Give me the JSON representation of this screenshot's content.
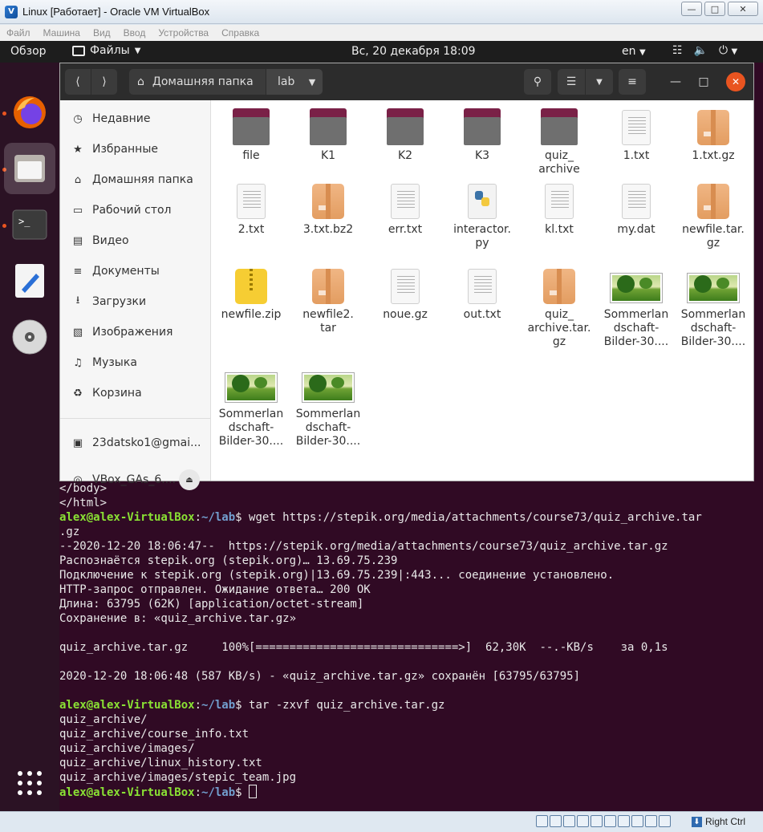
{
  "host": {
    "title": "Linux [Работает] - Oracle VM VirtualBox",
    "app_icon": "virtualbox-icon",
    "menu": [
      "Файл",
      "Машина",
      "Вид",
      "Ввод",
      "Устройства",
      "Справка"
    ],
    "host_key": "Right Ctrl"
  },
  "topbar": {
    "activities": "Обзор",
    "app_menu": "Файлы",
    "clock": "Вс, 20 декабря  18:09",
    "lang": "en"
  },
  "files": {
    "path_home": "Домашняя папка",
    "path_current": "lab",
    "sidebar": [
      {
        "label": "Недавние",
        "icon": "clock-icon"
      },
      {
        "label": "Избранные",
        "icon": "star-icon"
      },
      {
        "label": "Домашняя папка",
        "icon": "home-icon"
      },
      {
        "label": "Рабочий стол",
        "icon": "desktop-icon"
      },
      {
        "label": "Видео",
        "icon": "video-icon"
      },
      {
        "label": "Документы",
        "icon": "document-icon"
      },
      {
        "label": "Загрузки",
        "icon": "download-icon"
      },
      {
        "label": "Изображения",
        "icon": "image-icon"
      },
      {
        "label": "Музыка",
        "icon": "music-icon"
      },
      {
        "label": "Корзина",
        "icon": "trash-icon"
      },
      {
        "label": "23datsko1@gmai...",
        "icon": "network-drive-icon"
      },
      {
        "label": "VBox_GAs_6....",
        "icon": "optical-disc-icon"
      }
    ],
    "items": [
      {
        "name": "file",
        "type": "folder"
      },
      {
        "name": "K1",
        "type": "folder"
      },
      {
        "name": "K2",
        "type": "folder"
      },
      {
        "name": "K3",
        "type": "folder"
      },
      {
        "name": "quiz_\narchive",
        "type": "folder"
      },
      {
        "name": "1.txt",
        "type": "text"
      },
      {
        "name": "1.txt.gz",
        "type": "archive"
      },
      {
        "name": "2.txt",
        "type": "text"
      },
      {
        "name": "3.txt.bz2",
        "type": "archive"
      },
      {
        "name": "err.txt",
        "type": "text"
      },
      {
        "name": "interactor.\npy",
        "type": "python"
      },
      {
        "name": "kl.txt",
        "type": "text"
      },
      {
        "name": "my.dat",
        "type": "text"
      },
      {
        "name": "newfile.tar.\ngz",
        "type": "archive"
      },
      {
        "name": "newfile.zip",
        "type": "zip"
      },
      {
        "name": "newfile2.\ntar",
        "type": "archive"
      },
      {
        "name": "noue.gz",
        "type": "text"
      },
      {
        "name": "out.txt",
        "type": "text"
      },
      {
        "name": "quiz_\narchive.tar.\ngz",
        "type": "archive"
      },
      {
        "name": "Sommerlan\ndschaft-\nBilder-30....",
        "type": "image"
      },
      {
        "name": "Sommerlan\ndschaft-\nBilder-30....",
        "type": "image"
      },
      {
        "name": "Sommerlan\ndschaft-\nBilder-30....",
        "type": "image"
      },
      {
        "name": "Sommerlan\ndschaft-\nBilder-30....",
        "type": "image"
      }
    ]
  },
  "terminal": {
    "lines": [
      {
        "text": "</body>"
      },
      {
        "text": "</html>"
      },
      {
        "user": "alex@alex-VirtualBox",
        "path": "~/lab",
        "cmd": " wget https://stepik.org/media/attachments/course73/quiz_archive.tar"
      },
      {
        "text": ".gz"
      },
      {
        "text": "--2020-12-20 18:06:47--  https://stepik.org/media/attachments/course73/quiz_archive.tar.gz"
      },
      {
        "text": "Распознаётся stepik.org (stepik.org)… 13.69.75.239"
      },
      {
        "text": "Подключение к stepik.org (stepik.org)|13.69.75.239|:443... соединение установлено."
      },
      {
        "text": "HTTP-запрос отправлен. Ожидание ответа… 200 OK"
      },
      {
        "text": "Длина: 63795 (62K) [application/octet-stream]"
      },
      {
        "text": "Сохранение в: «quiz_archive.tar.gz»"
      },
      {
        "text": ""
      },
      {
        "text": "quiz_archive.tar.gz     100%[==============================>]  62,30K  --.-KB/s    за 0,1s"
      },
      {
        "text": ""
      },
      {
        "text": "2020-12-20 18:06:48 (587 KB/s) - «quiz_archive.tar.gz» сохранён [63795/63795]"
      },
      {
        "text": ""
      },
      {
        "user": "alex@alex-VirtualBox",
        "path": "~/lab",
        "cmd": " tar -zxvf quiz_archive.tar.gz"
      },
      {
        "text": "quiz_archive/"
      },
      {
        "text": "quiz_archive/course_info.txt"
      },
      {
        "text": "quiz_archive/images/"
      },
      {
        "text": "quiz_archive/linux_history.txt"
      },
      {
        "text": "quiz_archive/images/stepic_team.jpg"
      },
      {
        "user": "alex@alex-VirtualBox",
        "path": "~/lab",
        "cmd": " ",
        "cursor": true
      }
    ]
  }
}
